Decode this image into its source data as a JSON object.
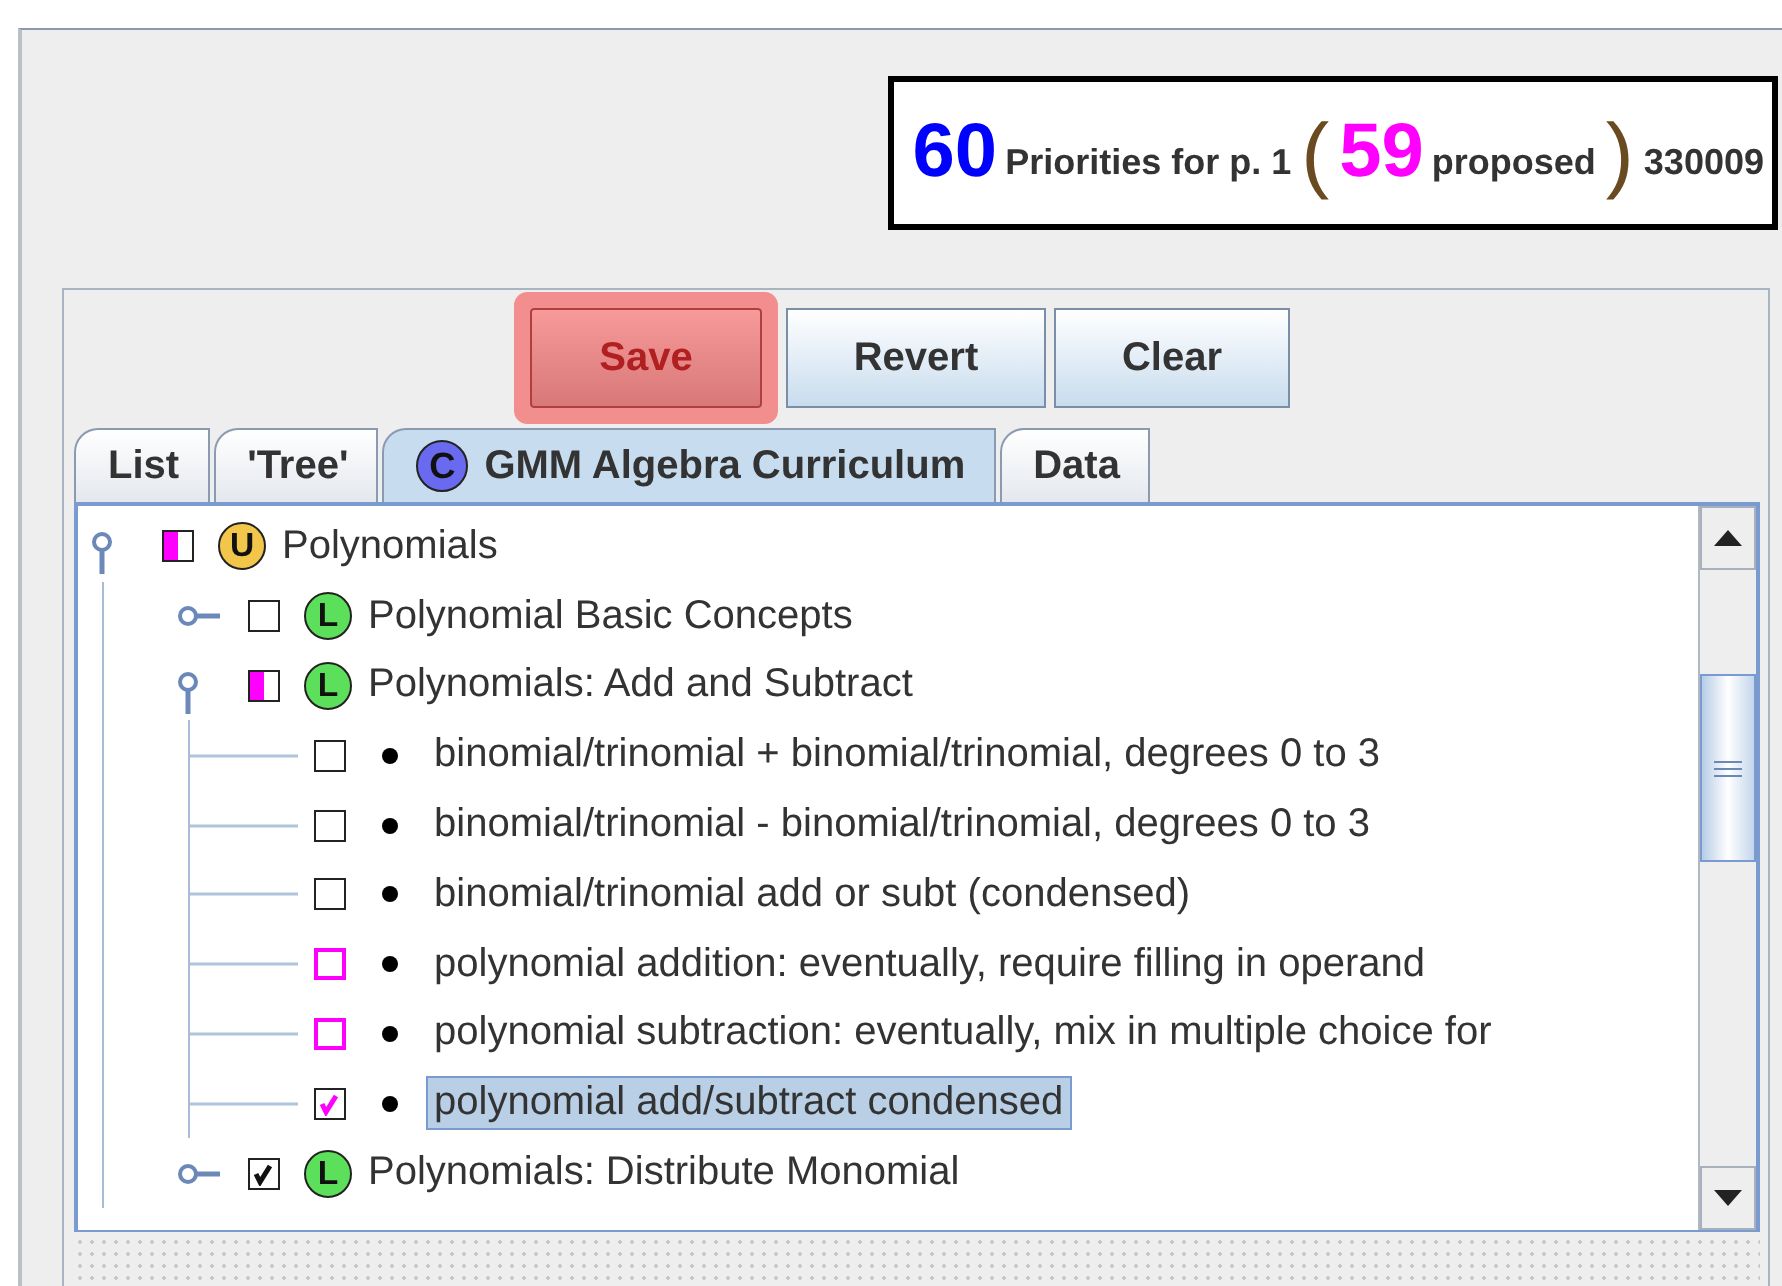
{
  "header": {
    "count": "60",
    "label": "Priorities for p. 1",
    "open": "(",
    "proposed_count": "59",
    "proposed_label": "proposed",
    "close": ")",
    "code": "330009"
  },
  "buttons": [
    {
      "label": "Save",
      "highlighted": true
    },
    {
      "label": "Revert",
      "highlighted": false
    },
    {
      "label": "Clear",
      "highlighted": false
    }
  ],
  "tabs": [
    {
      "label": "List",
      "selected": false
    },
    {
      "label": "'Tree'",
      "selected": false
    },
    {
      "label": "GMM Algebra Curriculum",
      "badge": "C",
      "color": "#6a6af0",
      "selected": true
    },
    {
      "label": "Data",
      "selected": false
    }
  ],
  "tree": [
    {
      "label": "Polynomials",
      "badge": "U",
      "color": "#f2c64a",
      "kind": "partial",
      "expanded": true,
      "selected": false,
      "children": [
        {
          "label": "Polynomial Basic Concepts",
          "badge": "L",
          "color": "#5ce05c",
          "kind": "plain",
          "checked": false,
          "expanded": false,
          "selected": false
        },
        {
          "label": "Polynomials: Add and Subtract",
          "badge": "L",
          "color": "#5ce05c",
          "kind": "partial",
          "expanded": true,
          "selected": false,
          "children": [
            {
              "label": "binomial/trinomial + binomial/trinomial, degrees 0 to 3",
              "kind": "plain",
              "checked": false,
              "selected": false
            },
            {
              "label": "binomial/trinomial - binomial/trinomial, degrees 0 to 3",
              "kind": "plain",
              "checked": false,
              "selected": false
            },
            {
              "label": "binomial/trinomial add or subt (condensed)",
              "kind": "plain",
              "checked": false,
              "selected": false
            },
            {
              "label": "polynomial addition: eventually, require filling in operand",
              "kind": "proposed",
              "checked": false,
              "selected": false
            },
            {
              "label": "polynomial subtraction: eventually, mix in multiple choice for",
              "kind": "proposed",
              "checked": false,
              "selected": false
            },
            {
              "label": "polynomial add/subtract condensed",
              "kind": "proposed",
              "checked": true,
              "selected": true
            }
          ]
        },
        {
          "label": "Polynomials: Distribute Monomial",
          "badge": "L",
          "color": "#5ce05c",
          "kind": "plain",
          "checked": true,
          "expanded": false,
          "selected": false
        }
      ]
    }
  ]
}
